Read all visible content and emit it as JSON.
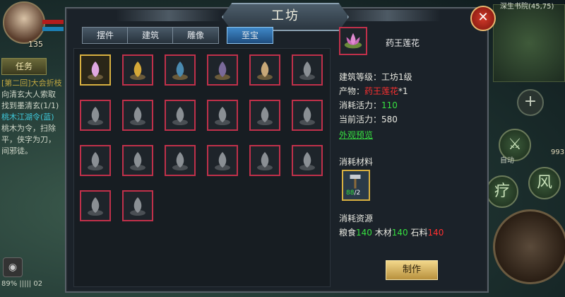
{
  "hud": {
    "level": "135",
    "quest_tab": "任务",
    "quest_lines": [
      "[第二回]大会折枝",
      "向清玄大人索取",
      "找到墨清玄(1/1)",
      "桃木江湖令(蓝)",
      "桃木为令，扫除",
      "平，侠字为刀，",
      "间邪徒。"
    ],
    "bottom_status": "89% ||||| 02",
    "coords": "深生书院(45,75)",
    "auto_label": "自动",
    "counter": "993",
    "skill1": "疗",
    "skill2": "风"
  },
  "panel": {
    "title": "工坊",
    "close_glyph": "✕",
    "tabs": [
      "摆件",
      "建筑",
      "雕像",
      "至宝"
    ],
    "active_tab_index": 3
  },
  "items": [
    {
      "name": "lotus-item",
      "locked": false,
      "selected": true
    },
    {
      "name": "golden-pagoda-item",
      "locked": false
    },
    {
      "name": "ornate-mirror-item",
      "locked": false
    },
    {
      "name": "censer-item",
      "locked": false
    },
    {
      "name": "gilded-shrine-item",
      "locked": false
    },
    {
      "name": "figurine-item",
      "locked": true
    },
    {
      "name": "scroll-book-item",
      "locked": true
    },
    {
      "name": "armillary-item",
      "locked": true
    },
    {
      "name": "drum-item",
      "locked": true
    },
    {
      "name": "reclining-statue-item",
      "locked": true
    },
    {
      "name": "robed-figure-item",
      "locked": true
    },
    {
      "name": "robed-figure-item-2",
      "locked": true
    },
    {
      "name": "hooded-figure-item",
      "locked": true
    },
    {
      "name": "hooded-figure-item-2",
      "locked": true
    },
    {
      "name": "bowing-figure-item",
      "locked": true
    },
    {
      "name": "gourd-item",
      "locked": true
    },
    {
      "name": "bamboo-slips-item",
      "locked": true
    },
    {
      "name": "shrine-gate-item",
      "locked": true
    },
    {
      "name": "tree-item",
      "locked": true
    },
    {
      "name": "horse-skeleton-item",
      "locked": true
    }
  ],
  "detail": {
    "item_name": "药王莲花",
    "build_level_label": "建筑等级：",
    "build_level_value": "工坊1级",
    "product_label": "产物：",
    "product_value": "药王莲花",
    "product_qty": "*1",
    "vitality_cost_label": "消耗活力：",
    "vitality_cost_value": "110",
    "vitality_current_label": "当前活力：",
    "vitality_current_value": "580",
    "preview_link": "外观预览",
    "materials_heading": "消耗材料",
    "material_have": "88",
    "material_need": "/2",
    "resources_heading": "消耗资源",
    "res_food_label": "粮食",
    "res_food_value": "140",
    "res_wood_label": "木材",
    "res_wood_value": "140",
    "res_stone_label": "石料",
    "res_stone_value": "140",
    "make_button": "制作"
  },
  "colors": {
    "locked_border": "#c0304a",
    "selected_border": "#d8b040",
    "ok_green": "#36e040",
    "warn_red": "#ff3030",
    "active_tab": "#3f88c8"
  }
}
